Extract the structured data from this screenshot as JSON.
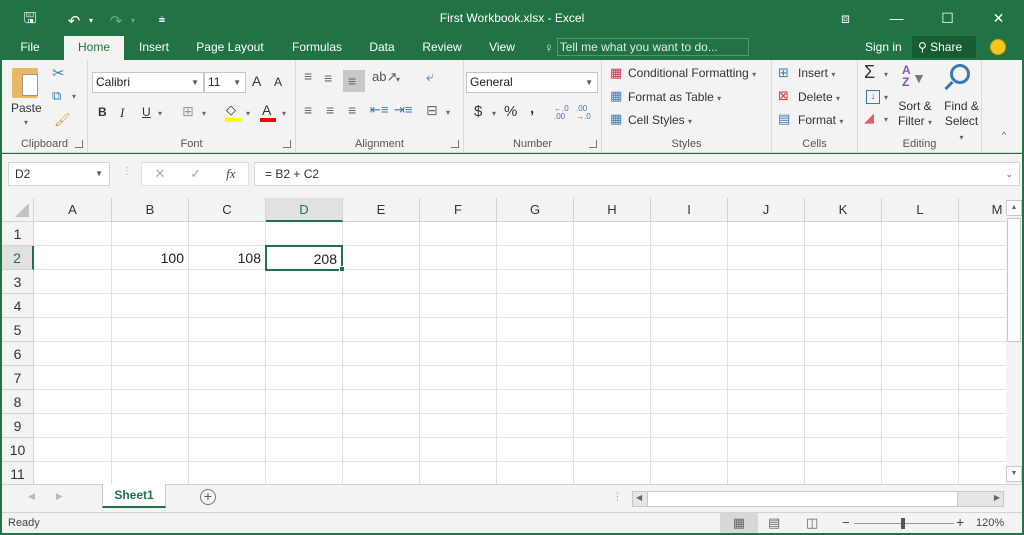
{
  "window": {
    "title": "First Workbook.xlsx - Excel",
    "controls": {
      "ribbon_display": "⧈",
      "minimize": "—",
      "maximize": "☐",
      "close": "✕"
    }
  },
  "qat": {
    "save": "🖫",
    "undo": "↶",
    "undo_dd": "▾",
    "redo": "↷",
    "redo_dd": "▾",
    "customize": "⩧"
  },
  "tabs": [
    "File",
    "Home",
    "Insert",
    "Page Layout",
    "Formulas",
    "Data",
    "Review",
    "View"
  ],
  "active_tab": "Home",
  "tellme": {
    "placeholder": "Tell me what you want to do..."
  },
  "account": {
    "signin": "Sign in",
    "share": "Share"
  },
  "ribbon": {
    "clipboard": {
      "label": "Clipboard",
      "paste": "Paste"
    },
    "font": {
      "label": "Font",
      "name": "Calibri",
      "size": "11",
      "bold": "B",
      "italic": "I",
      "underline": "U",
      "grow": "A",
      "shrink": "A",
      "font_color": "A",
      "fill_color": "#ffff00",
      "font_color_value": "#ff0000"
    },
    "alignment": {
      "label": "Alignment"
    },
    "number": {
      "label": "Number",
      "format": "General",
      "currency": "$",
      "percent": "%",
      "comma": ",",
      "inc_decimal": "←.0 .00",
      "dec_decimal": ".00 →.0"
    },
    "styles": {
      "label": "Styles",
      "conditional": "Conditional Formatting",
      "format_table": "Format as Table",
      "cell_styles": "Cell Styles"
    },
    "cells": {
      "label": "Cells",
      "insert": "Insert",
      "delete": "Delete",
      "format": "Format"
    },
    "editing": {
      "label": "Editing",
      "sum": "Σ",
      "sort_filter_1": "Sort &",
      "sort_filter_2": "Filter",
      "find_select_1": "Find &",
      "find_select_2": "Select"
    }
  },
  "formula_bar": {
    "name_box": "D2",
    "formula": "= B2 + C2",
    "cancel": "✕",
    "enter": "✓",
    "fx": "fx"
  },
  "grid": {
    "columns": [
      "A",
      "B",
      "C",
      "D",
      "E",
      "F",
      "G",
      "H",
      "I",
      "J",
      "K",
      "L",
      "M"
    ],
    "rows": [
      "1",
      "2",
      "3",
      "4",
      "5",
      "6",
      "7",
      "8",
      "9",
      "10",
      "11"
    ],
    "selected_cell": "D2",
    "cells": [
      {
        "ref": "B2",
        "value": "100"
      },
      {
        "ref": "C2",
        "value": "108"
      },
      {
        "ref": "D2",
        "value": "208"
      }
    ]
  },
  "sheets": {
    "tabs": [
      "Sheet1"
    ],
    "active": "Sheet1",
    "add": "+"
  },
  "status": {
    "text": "Ready",
    "zoom": "120%",
    "zoom_minus": "−",
    "zoom_plus": "+"
  },
  "colors": {
    "accent": "#217346"
  }
}
